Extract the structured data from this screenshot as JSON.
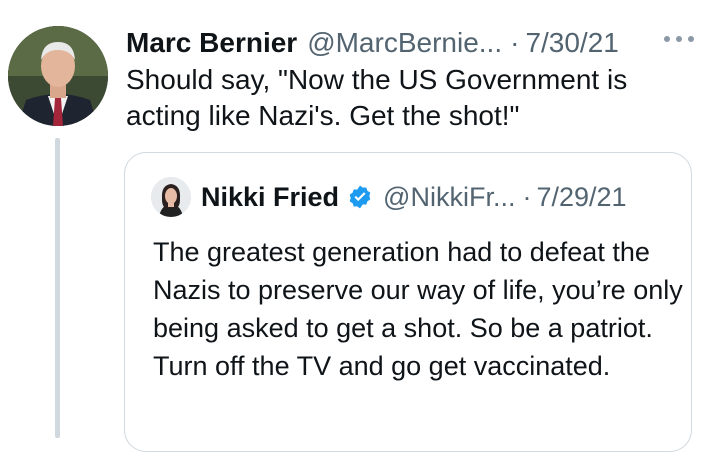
{
  "tweet": {
    "author_name": "Marc Bernier",
    "author_handle": "@MarcBernie...",
    "separator": "·",
    "timestamp": "7/30/21",
    "more_icon": "ellipsis-icon",
    "text": "Should say, \"Now the US Government is acting like Nazi's. Get the shot!\""
  },
  "quoted": {
    "author_name": "Nikki Fried",
    "verified_icon": "verified-badge-icon",
    "author_handle": "@NikkiFr...",
    "separator": "·",
    "timestamp": "7/29/21",
    "text": "The greatest generation had to defeat the Nazis to preserve our way of life, you’re only being asked to get a shot. So be a patriot. Turn off the TV and go get vaccinated."
  },
  "colors": {
    "text": "#0f1419",
    "secondary": "#536471",
    "border": "#cfd9de",
    "verified": "#1d9bf0"
  }
}
